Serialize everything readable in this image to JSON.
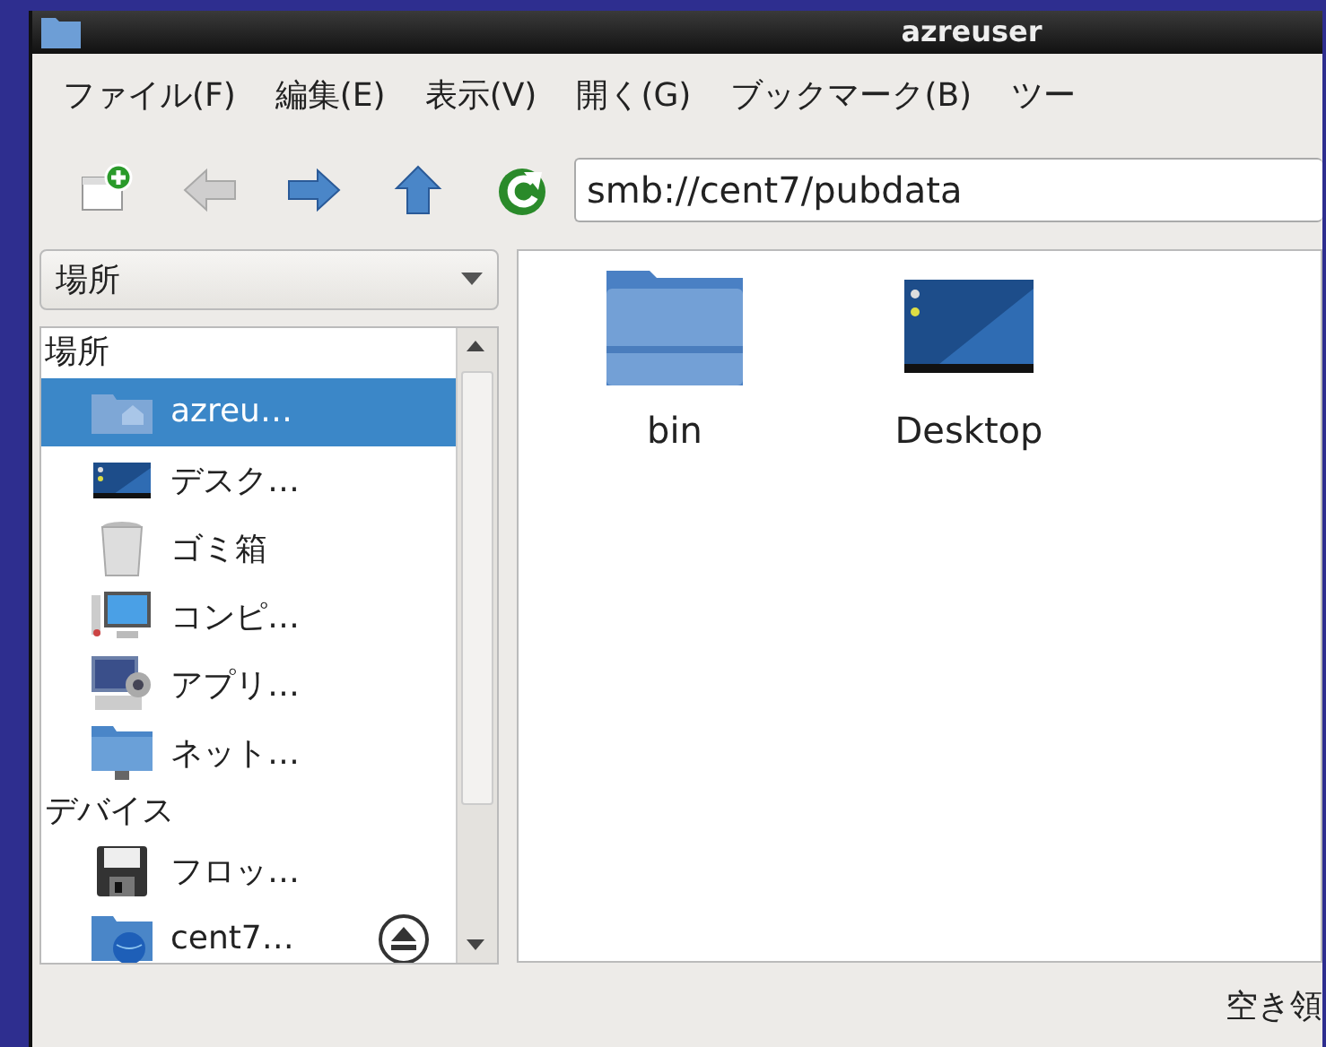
{
  "window": {
    "title": "azreuser"
  },
  "menu": [
    "ファイル(F)",
    "編集(E)",
    "表示(V)",
    "開く(G)",
    "ブックマーク(B)",
    "ツー"
  ],
  "toolbar": {
    "buttons": [
      {
        "kind": "new-tab",
        "disabled": false
      },
      {
        "kind": "back",
        "disabled": true
      },
      {
        "kind": "forward",
        "disabled": false
      },
      {
        "kind": "up",
        "disabled": false
      },
      {
        "kind": "reload",
        "disabled": false
      }
    ],
    "location": "smb://cent7/pubdata"
  },
  "sidebar": {
    "mode": "場所",
    "sections": [
      {
        "heading": "場所",
        "items": [
          {
            "label": "azreu…",
            "selected": true,
            "eject": false
          },
          {
            "label": "デスク…",
            "selected": false,
            "eject": false
          },
          {
            "label": "ゴミ箱",
            "selected": false,
            "eject": false
          },
          {
            "label": "コンピ…",
            "selected": false,
            "eject": false
          },
          {
            "label": "アプリ…",
            "selected": false,
            "eject": false
          },
          {
            "label": "ネット…",
            "selected": false,
            "eject": false
          }
        ]
      },
      {
        "heading": "デバイス",
        "items": [
          {
            "label": "フロッ…",
            "selected": false,
            "eject": false
          },
          {
            "label": "cent7…",
            "selected": false,
            "eject": true
          }
        ]
      }
    ]
  },
  "files": [
    {
      "name": "bin",
      "kind": "folder"
    },
    {
      "name": "Desktop",
      "kind": "desktop"
    }
  ],
  "status_bar": "空き領"
}
